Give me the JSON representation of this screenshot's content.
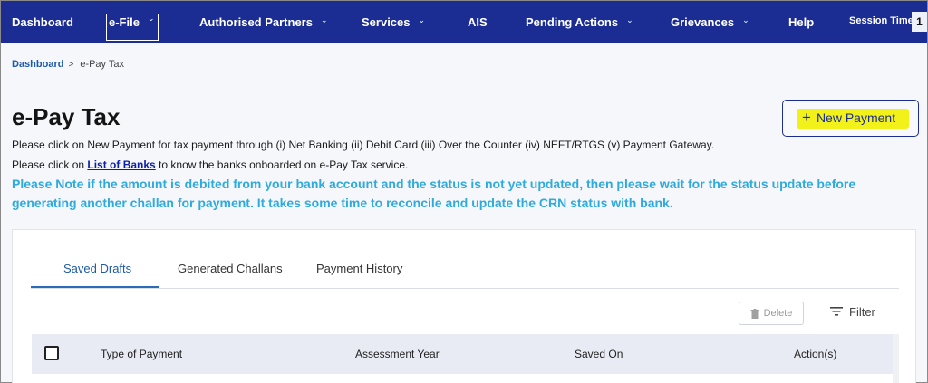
{
  "nav": {
    "items": [
      {
        "label": "Dashboard",
        "dropdown": false
      },
      {
        "label": "e-File",
        "dropdown": true
      },
      {
        "label": "Authorised Partners",
        "dropdown": true
      },
      {
        "label": "Services",
        "dropdown": true
      },
      {
        "label": "AIS",
        "dropdown": false
      },
      {
        "label": "Pending Actions",
        "dropdown": true
      },
      {
        "label": "Grievances",
        "dropdown": true
      },
      {
        "label": "Help",
        "dropdown": false
      }
    ],
    "session_label": "Session Time",
    "session_value": "1"
  },
  "breadcrumb": {
    "home": "Dashboard",
    "separator": ">",
    "current": "e-Pay Tax"
  },
  "page": {
    "title": "e-Pay Tax",
    "info1": "Please click on New Payment for tax payment through (i) Net Banking (ii) Debit Card (iii) Over the Counter (iv) NEFT/RTGS (v) Payment Gateway.",
    "info2_prefix": "Please click on ",
    "info2_link": "List of Banks",
    "info2_suffix": " to know the banks onboarded on e-Pay Tax service.",
    "note": "Please Note if the amount is debited from your bank account and the status is not yet updated, then please wait for the status update before generating another challan for payment. It takes some time to reconcile and update the CRN status with bank.",
    "new_payment_label": "New Payment",
    "new_payment_icon": "plus-icon"
  },
  "tabs": [
    {
      "label": "Saved Drafts",
      "active": true
    },
    {
      "label": "Generated Challans",
      "active": false
    },
    {
      "label": "Payment History",
      "active": false
    }
  ],
  "toolbar": {
    "delete_label": "Delete",
    "delete_icon": "trash-icon",
    "filter_label": "Filter",
    "filter_icon": "filter-icon"
  },
  "table": {
    "columns": [
      "Type of Payment",
      "Assessment Year",
      "Saved On",
      "Action(s)"
    ]
  },
  "colors": {
    "nav_bg": "#1b2d93",
    "note_text": "#2eaadc",
    "active_tab": "#1d5aa8",
    "highlight": "#f2f21a"
  }
}
